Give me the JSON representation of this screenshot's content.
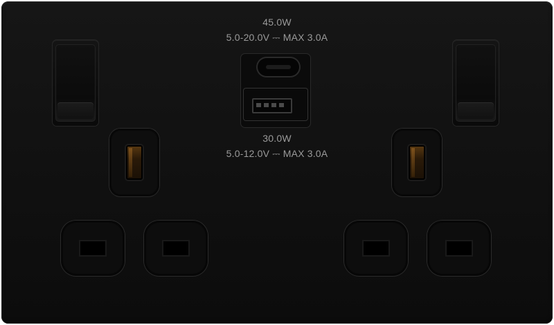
{
  "usb_c_port": {
    "power": "45.0W",
    "spec": "5.0-20.0V ⎓ MAX 3.0A"
  },
  "usb_a_port": {
    "power": "30.0W",
    "spec": "5.0-12.0V ⎓ MAX 3.0A"
  }
}
